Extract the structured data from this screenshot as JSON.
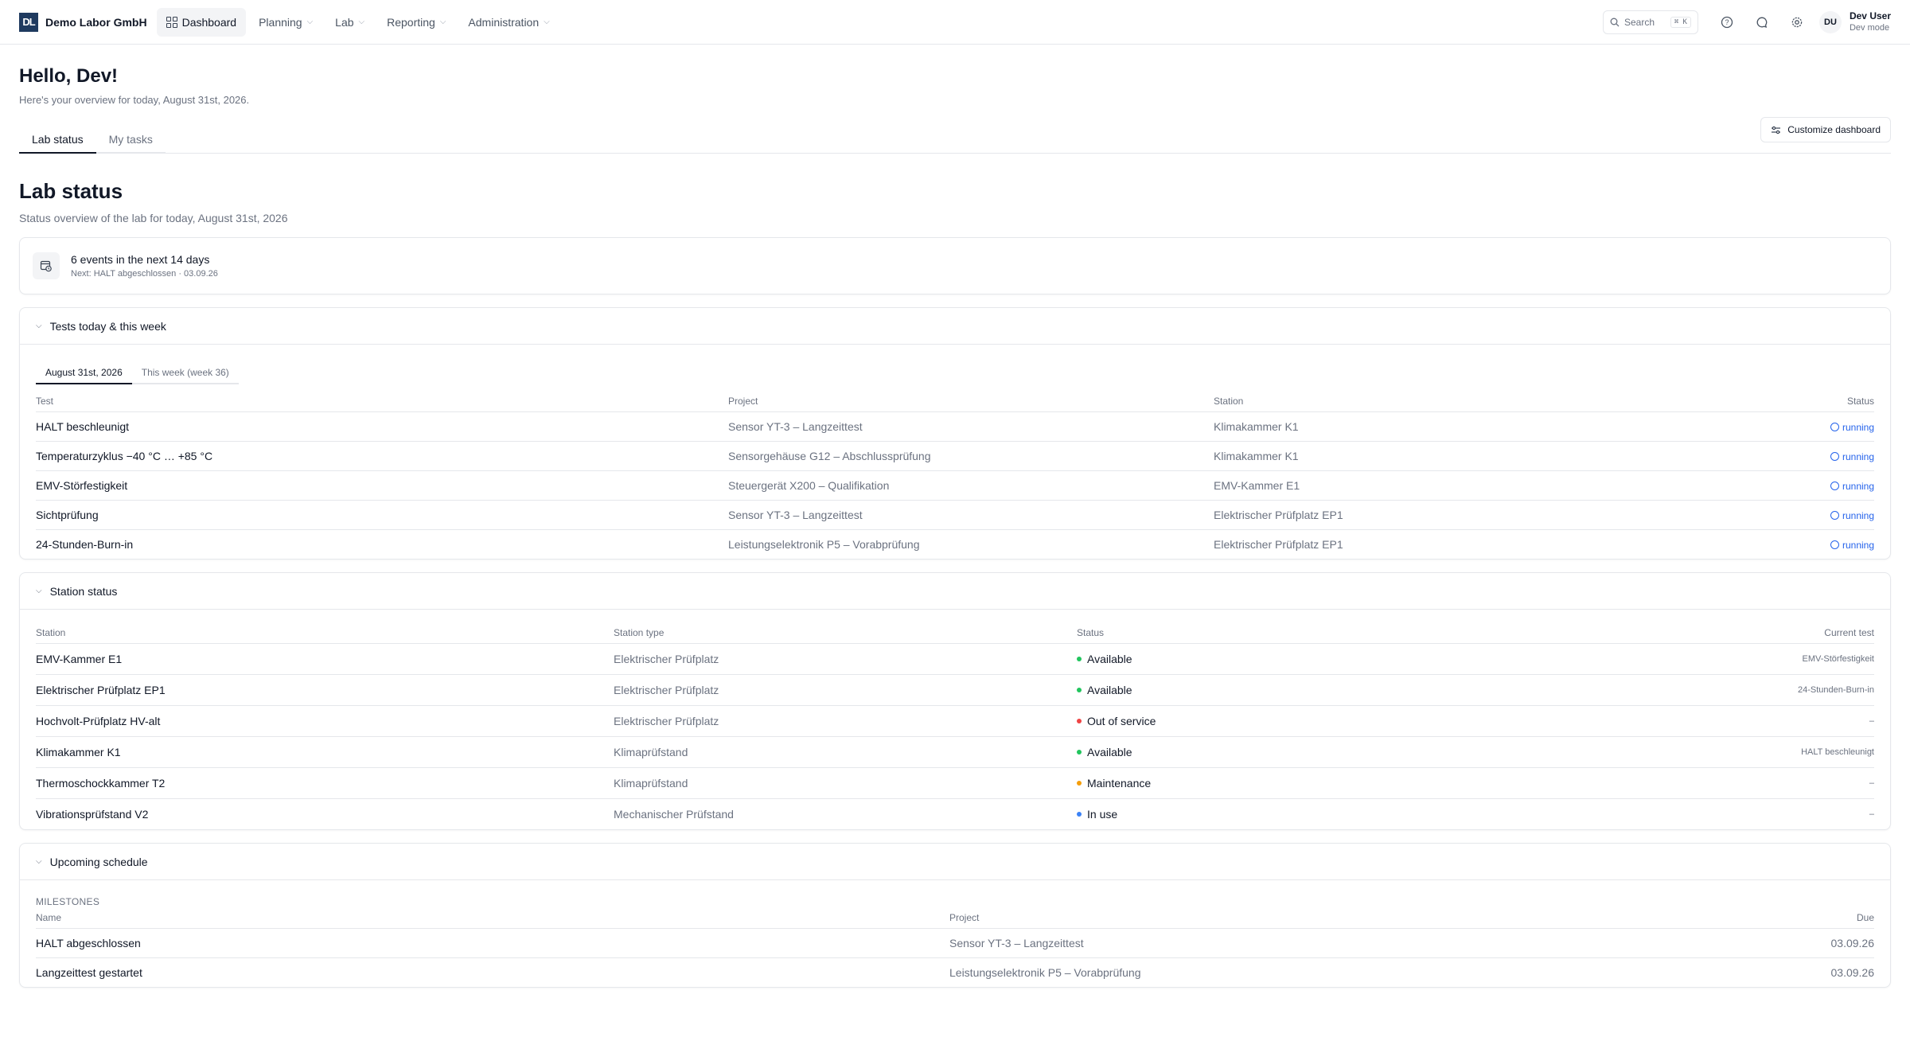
{
  "brand": {
    "logo": "DL",
    "name": "Demo Labor GmbH"
  },
  "nav": [
    {
      "label": "Dashboard",
      "active": true
    },
    {
      "label": "Planning"
    },
    {
      "label": "Lab"
    },
    {
      "label": "Reporting"
    },
    {
      "label": "Administration"
    }
  ],
  "search": {
    "placeholder": "Search",
    "shortcut": "⌘ K"
  },
  "user": {
    "initials": "DU",
    "name": "Dev User",
    "mode": "Dev mode"
  },
  "greeting": {
    "title": "Hello, Dev!",
    "subtitle": "Here's your overview for today, August 31st, 2026."
  },
  "tabs": [
    {
      "label": "Lab status"
    },
    {
      "label": "My tasks"
    }
  ],
  "customize_label": "Customize dashboard",
  "lab_status": {
    "title": "Lab status",
    "subtitle": "Status overview of the lab for today, August 31st, 2026"
  },
  "events": {
    "title": "6 events in the next 14 days",
    "next": "Next: HALT abgeschlossen · 03.09.26"
  },
  "tests": {
    "title": "Tests today & this week",
    "subtabs": [
      {
        "label": "August 31st, 2026"
      },
      {
        "label": "This week (week 36)"
      }
    ],
    "columns": {
      "test": "Test",
      "project": "Project",
      "station": "Station",
      "status": "Status"
    },
    "rows": [
      {
        "test": "HALT beschleunigt",
        "project": "Sensor YT-3 – Langzeittest",
        "station": "Klimakammer K1",
        "status": "running"
      },
      {
        "test": "Temperaturzyklus −40 °C … +85 °C",
        "project": "Sensorgehäuse G12 – Abschlussprüfung",
        "station": "Klimakammer K1",
        "status": "running"
      },
      {
        "test": "EMV-Störfestigkeit",
        "project": "Steuergerät X200 – Qualifikation",
        "station": "EMV-Kammer E1",
        "status": "running"
      },
      {
        "test": "Sichtprüfung",
        "project": "Sensor YT-3 – Langzeittest",
        "station": "Elektrischer Prüfplatz EP1",
        "status": "running"
      },
      {
        "test": "24-Stunden-Burn-in",
        "project": "Leistungselektronik P5 – Vorabprüfung",
        "station": "Elektrischer Prüfplatz EP1",
        "status": "running"
      }
    ]
  },
  "stations": {
    "title": "Station status",
    "columns": {
      "station": "Station",
      "type": "Station type",
      "status": "Status",
      "current": "Current test"
    },
    "rows": [
      {
        "station": "EMV-Kammer E1",
        "type": "Elektrischer Prüfplatz",
        "status": "Available",
        "color": "#22c55e",
        "current": "EMV-Störfestigkeit"
      },
      {
        "station": "Elektrischer Prüfplatz EP1",
        "type": "Elektrischer Prüfplatz",
        "status": "Available",
        "color": "#22c55e",
        "current": "24-Stunden-Burn-in"
      },
      {
        "station": "Hochvolt-Prüfplatz HV-alt",
        "type": "Elektrischer Prüfplatz",
        "status": "Out of service",
        "color": "#ef4444",
        "current": "–"
      },
      {
        "station": "Klimakammer K1",
        "type": "Klimaprüfstand",
        "status": "Available",
        "color": "#22c55e",
        "current": "HALT beschleunigt"
      },
      {
        "station": "Thermoschockkammer T2",
        "type": "Klimaprüfstand",
        "status": "Maintenance",
        "color": "#f59e0b",
        "current": "–"
      },
      {
        "station": "Vibrationsprüfstand V2",
        "type": "Mechanischer Prüfstand",
        "status": "In use",
        "color": "#3b82f6",
        "current": "–"
      }
    ]
  },
  "schedule": {
    "title": "Upcoming schedule",
    "milestones_label": "MILESTONES",
    "columns": {
      "name": "Name",
      "project": "Project",
      "due": "Due"
    },
    "rows": [
      {
        "name": "HALT abgeschlossen",
        "project": "Sensor YT-3 – Langzeittest",
        "due": "03.09.26"
      },
      {
        "name": "Langzeittest gestartet",
        "project": "Leistungselektronik P5 – Vorabprüfung",
        "due": "03.09.26"
      }
    ]
  }
}
